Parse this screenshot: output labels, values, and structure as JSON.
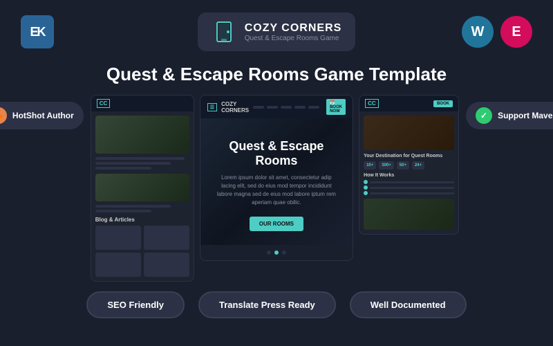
{
  "header": {
    "logo_left_text": "EK",
    "center_logo_title": "COZY CORNERS",
    "center_logo_subtitle": "Quest & Escape Rooms Game",
    "wp_logo": "W",
    "el_logo": "E"
  },
  "main_title": "Quest & Escape Rooms Game Template",
  "left_badge": {
    "label": "HotShot Author",
    "icon": "🔥"
  },
  "right_badge": {
    "label": "Support Maverik",
    "icon": "✓"
  },
  "screen_center": {
    "nav_brand": "COZY CORNERS",
    "hero_title": "Quest & Escape Rooms",
    "hero_desc": "Lorem ipsum dolor sit amet, consectetur adip lacing elit, sed do eius mod tempor incididunt labore magna sed de eius mod labore iptum rem aperiam quae obilic.",
    "hero_btn": "OUR ROOMS"
  },
  "screen_left": {
    "section_title": "Blog & Articles"
  },
  "screen_right": {
    "title": "Your Destination for Quest Rooms",
    "stats": [
      "10+",
      "300+",
      "50+",
      "24+"
    ],
    "how_works": "How It Works"
  },
  "bottom_badges": {
    "seo": "SEO Friendly",
    "translate": "Translate Press Ready",
    "documented": "Well Documented"
  }
}
